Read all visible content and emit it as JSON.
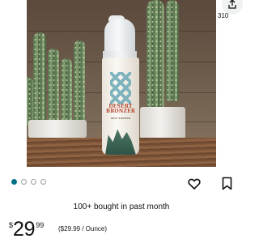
{
  "header": {
    "cart_count": "310"
  },
  "product": {
    "image_alt": "Desert Bronzer foaming tanning mousse bottle on wooden table",
    "bottle_brand_label": "DESERT BRONZER",
    "bottle_sub_label": "SELF TANNER"
  },
  "gallery": {
    "dot_count": 4,
    "active_index": 0
  },
  "social_proof": {
    "bought_text": "100+ bought in past month"
  },
  "price": {
    "symbol": "$",
    "whole": "29",
    "fraction": "99",
    "unit_price": "($29.99 / Ounce)"
  },
  "colors": {
    "accent": "#007185",
    "text": "#0f1111"
  }
}
